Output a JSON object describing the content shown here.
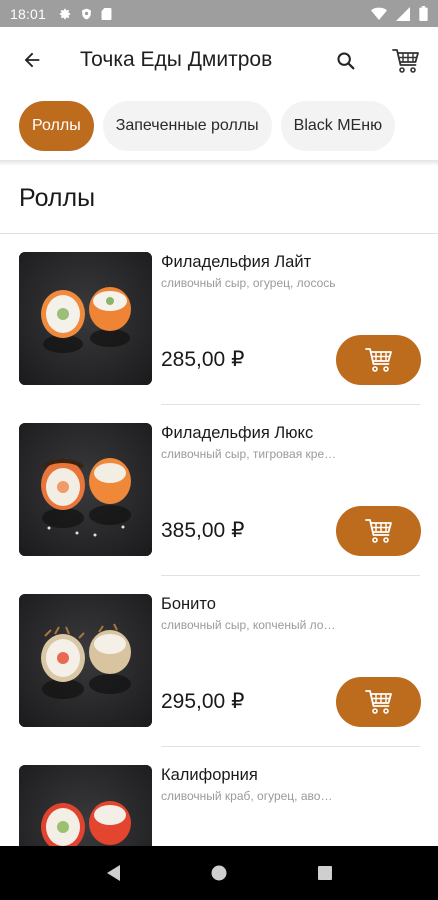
{
  "status_bar": {
    "time": "18:01",
    "icons": [
      "gear-icon",
      "shield-icon",
      "sd-card-icon",
      "wifi-icon",
      "cellular-icon",
      "battery-icon"
    ]
  },
  "app_bar": {
    "title": "Точка Еды Дмитров",
    "back_icon": "arrow-left-icon",
    "search_icon": "search-icon",
    "cart_icon": "cart-icon"
  },
  "categories": {
    "items": [
      {
        "label": "Роллы",
        "active": true
      },
      {
        "label": "Запеченные роллы",
        "active": false
      },
      {
        "label": "Black MEню",
        "active": false
      }
    ]
  },
  "section": {
    "title": "Роллы"
  },
  "products": [
    {
      "name": "Филадельфия Лайт",
      "description": "сливочный сыр, огурец, лосось",
      "price": "285,00 ₽"
    },
    {
      "name": "Филадельфия Люкс",
      "description": "сливочный сыр, тигровая креветка",
      "price": "385,00 ₽"
    },
    {
      "name": "Бонито",
      "description": "сливочный сыр, копченый лосось",
      "price": "295,00 ₽"
    },
    {
      "name": "Калифорния",
      "description": "сливочный краб, огурец, авокадо",
      "price": ""
    }
  ],
  "nav_bar": {
    "icons": [
      "back-triangle-icon",
      "home-circle-icon",
      "recents-square-icon"
    ]
  },
  "colors": {
    "accent": "#bd6c1e",
    "status_bar": "#9e9e9e",
    "nav_bar": "#000000"
  }
}
